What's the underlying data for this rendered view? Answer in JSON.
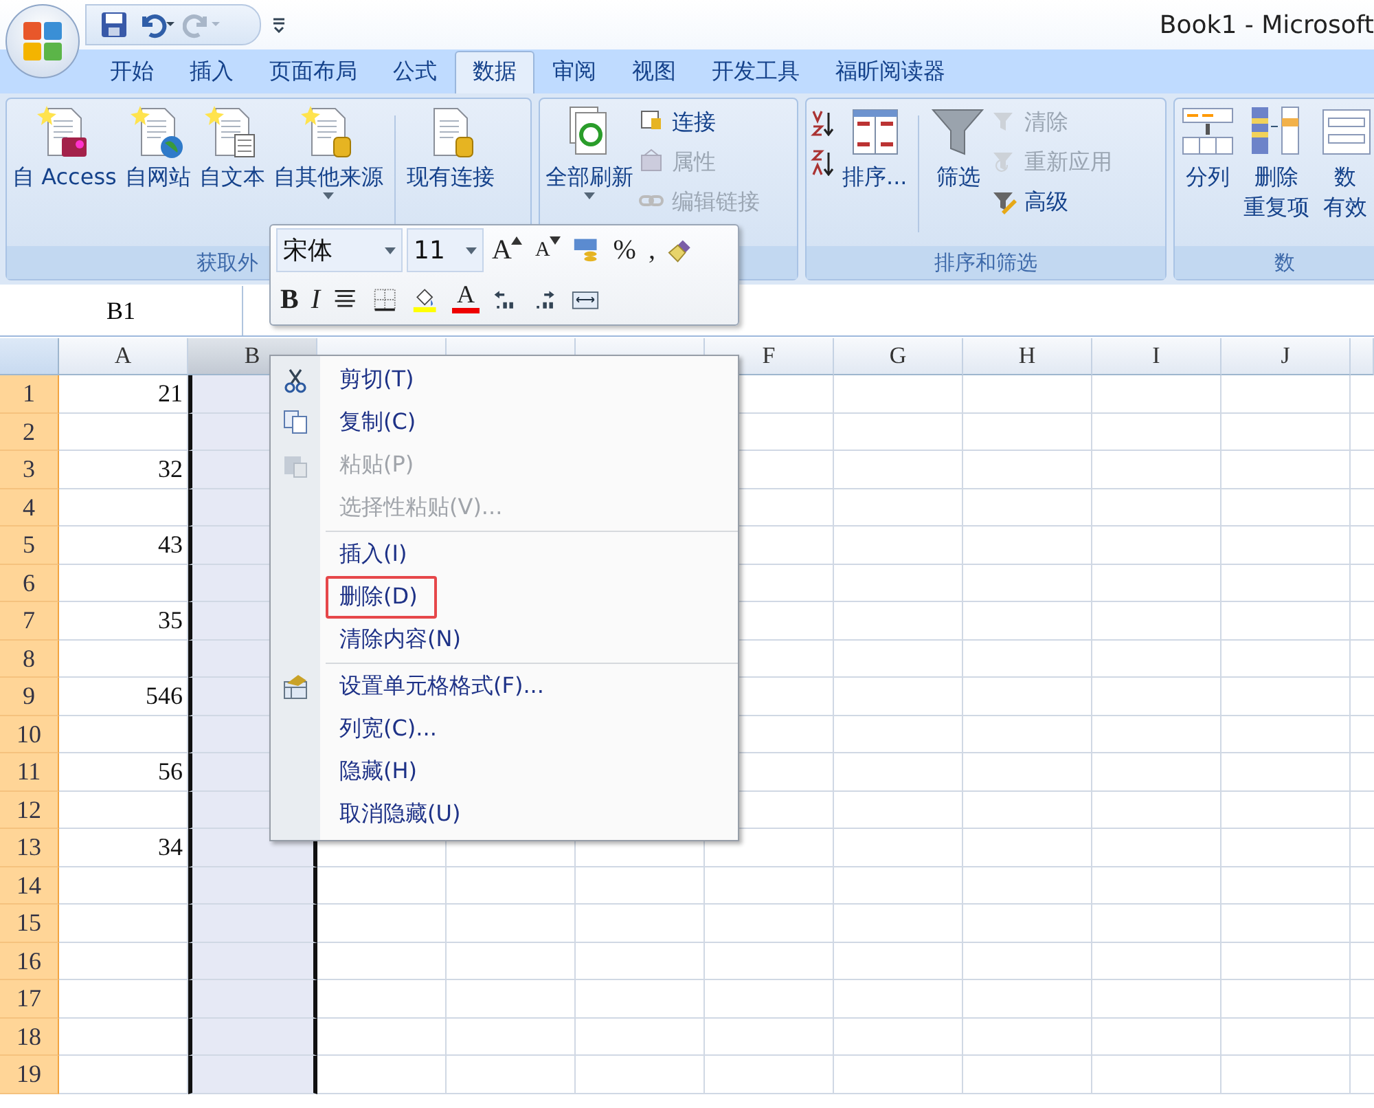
{
  "window": {
    "title": "Book1 - Microsoft"
  },
  "tabs": [
    {
      "label": "开始",
      "selected": false
    },
    {
      "label": "插入",
      "selected": false
    },
    {
      "label": "页面布局",
      "selected": false
    },
    {
      "label": "公式",
      "selected": false
    },
    {
      "label": "数据",
      "selected": true
    },
    {
      "label": "审阅",
      "selected": false
    },
    {
      "label": "视图",
      "selected": false
    },
    {
      "label": "开发工具",
      "selected": false
    },
    {
      "label": "福昕阅读器",
      "selected": false
    }
  ],
  "ribbon": {
    "groups": [
      {
        "label": "获取外",
        "buttons": [
          {
            "kind": "large",
            "label": "自 Access",
            "disabled": false,
            "dropdown": false
          },
          {
            "kind": "large",
            "label": "自网站",
            "disabled": false,
            "dropdown": false
          },
          {
            "kind": "large",
            "label": "自文本",
            "disabled": false,
            "dropdown": false
          },
          {
            "kind": "large",
            "label": "自其他来源",
            "disabled": false,
            "dropdown": true
          },
          {
            "kind": "divider"
          },
          {
            "kind": "large",
            "label": "现有连接",
            "disabled": false,
            "dropdown": false
          }
        ]
      },
      {
        "buttons": [
          {
            "kind": "large",
            "label": "全部刷新",
            "disabled": false,
            "dropdown": true
          },
          {
            "kind": "small",
            "label": "连接",
            "disabled": false
          },
          {
            "kind": "small",
            "label": "属性",
            "disabled": true
          },
          {
            "kind": "small",
            "label": "编辑链接",
            "disabled": true
          }
        ]
      },
      {
        "label": "排序和筛选",
        "buttons": [
          {
            "kind": "icon"
          },
          {
            "kind": "icon"
          },
          {
            "kind": "large",
            "label": "排序...",
            "disabled": false,
            "dropdown": false
          },
          {
            "kind": "divider"
          },
          {
            "kind": "large",
            "label": "筛选",
            "disabled": false,
            "dropdown": false
          },
          {
            "kind": "small",
            "label": "清除",
            "disabled": true
          },
          {
            "kind": "small",
            "label": "重新应用",
            "disabled": true
          },
          {
            "kind": "small",
            "label": "高级",
            "disabled": false
          }
        ]
      },
      {
        "label": "数",
        "buttons": [
          {
            "kind": "large",
            "label": "分列",
            "disabled": false,
            "dropdown": false
          },
          {
            "kind": "large",
            "lines": [
              "删除",
              "重复项"
            ],
            "disabled": false,
            "dropdown": false
          },
          {
            "kind": "large",
            "lines": [
              "数",
              "有效"
            ],
            "disabled": false,
            "dropdown": false
          }
        ]
      }
    ]
  },
  "name_box": "B1",
  "mini_toolbar": {
    "font": "宋体",
    "size": "11",
    "row_1": [
      {
        "kind": "grow",
        "text": "A"
      },
      {
        "kind": "shrink",
        "text": "A"
      },
      {
        "kind": "icon"
      },
      {
        "kind": "text",
        "text": "%"
      },
      {
        "kind": "text",
        "text": ","
      },
      {
        "kind": "icon"
      }
    ],
    "row_2": [
      {
        "kind": "bold",
        "text": "B"
      },
      {
        "kind": "italic",
        "text": "I"
      },
      {
        "kind": "icon"
      },
      {
        "kind": "icon"
      },
      {
        "kind": "icon"
      },
      {
        "kind": "font_color",
        "text": "A"
      },
      {
        "kind": "icon"
      },
      {
        "kind": "icon"
      },
      {
        "kind": "icon"
      }
    ]
  },
  "columns": [
    {
      "label": "A",
      "selected": false
    },
    {
      "label": "B",
      "selected": true
    },
    {
      "selected": false
    },
    {
      "selected": false
    },
    {
      "selected": false
    },
    {
      "label": "F",
      "selected": false
    },
    {
      "label": "G",
      "selected": false
    },
    {
      "label": "H",
      "selected": false
    },
    {
      "label": "I",
      "selected": false
    },
    {
      "label": "J",
      "selected": false
    }
  ],
  "rows": [
    {
      "header": "1",
      "highlighted": true,
      "cell_a": "21"
    },
    {
      "header": "2",
      "highlighted": true
    },
    {
      "header": "3",
      "highlighted": true,
      "cell_a": "32"
    },
    {
      "header": "4",
      "highlighted": true
    },
    {
      "header": "5",
      "highlighted": true,
      "cell_a": "43"
    },
    {
      "header": "6",
      "highlighted": true
    },
    {
      "header": "7",
      "highlighted": true,
      "cell_a": "35"
    },
    {
      "header": "8",
      "highlighted": true
    },
    {
      "header": "9",
      "highlighted": true,
      "cell_a": "546"
    },
    {
      "header": "10",
      "highlighted": true
    },
    {
      "header": "11",
      "highlighted": true,
      "cell_a": "56"
    },
    {
      "header": "12",
      "highlighted": true
    },
    {
      "header": "13",
      "highlighted": true,
      "cell_a": "34"
    },
    {
      "header": "14",
      "highlighted": true
    },
    {
      "header": "15",
      "highlighted": true
    },
    {
      "header": "16",
      "highlighted": true
    },
    {
      "header": "17",
      "highlighted": true
    },
    {
      "header": "18",
      "highlighted": true
    },
    {
      "header": "19",
      "highlighted": true
    }
  ],
  "context_menu": [
    {
      "kind": "item",
      "label": "剪切(T)",
      "disabled": false,
      "highlighted": false
    },
    {
      "kind": "item",
      "label": "复制(C)",
      "disabled": false,
      "highlighted": false
    },
    {
      "kind": "item",
      "label": "粘贴(P)",
      "disabled": true,
      "highlighted": false
    },
    {
      "kind": "item",
      "label": "选择性粘贴(V)...",
      "disabled": true,
      "highlighted": false
    },
    {
      "kind": "separator"
    },
    {
      "kind": "item",
      "label": "插入(I)",
      "disabled": false,
      "highlighted": false
    },
    {
      "kind": "item",
      "label": "删除(D)",
      "disabled": false,
      "highlighted": true
    },
    {
      "kind": "item",
      "label": "清除内容(N)",
      "disabled": false,
      "highlighted": false
    },
    {
      "kind": "separator"
    },
    {
      "kind": "item",
      "label": "设置单元格格式(F)...",
      "disabled": false,
      "highlighted": false
    },
    {
      "kind": "item",
      "label": "列宽(C)...",
      "disabled": false,
      "highlighted": false
    },
    {
      "kind": "item",
      "label": "隐藏(H)",
      "disabled": false,
      "highlighted": false
    },
    {
      "kind": "item",
      "label": "取消隐藏(U)",
      "disabled": false,
      "highlighted": false
    }
  ]
}
